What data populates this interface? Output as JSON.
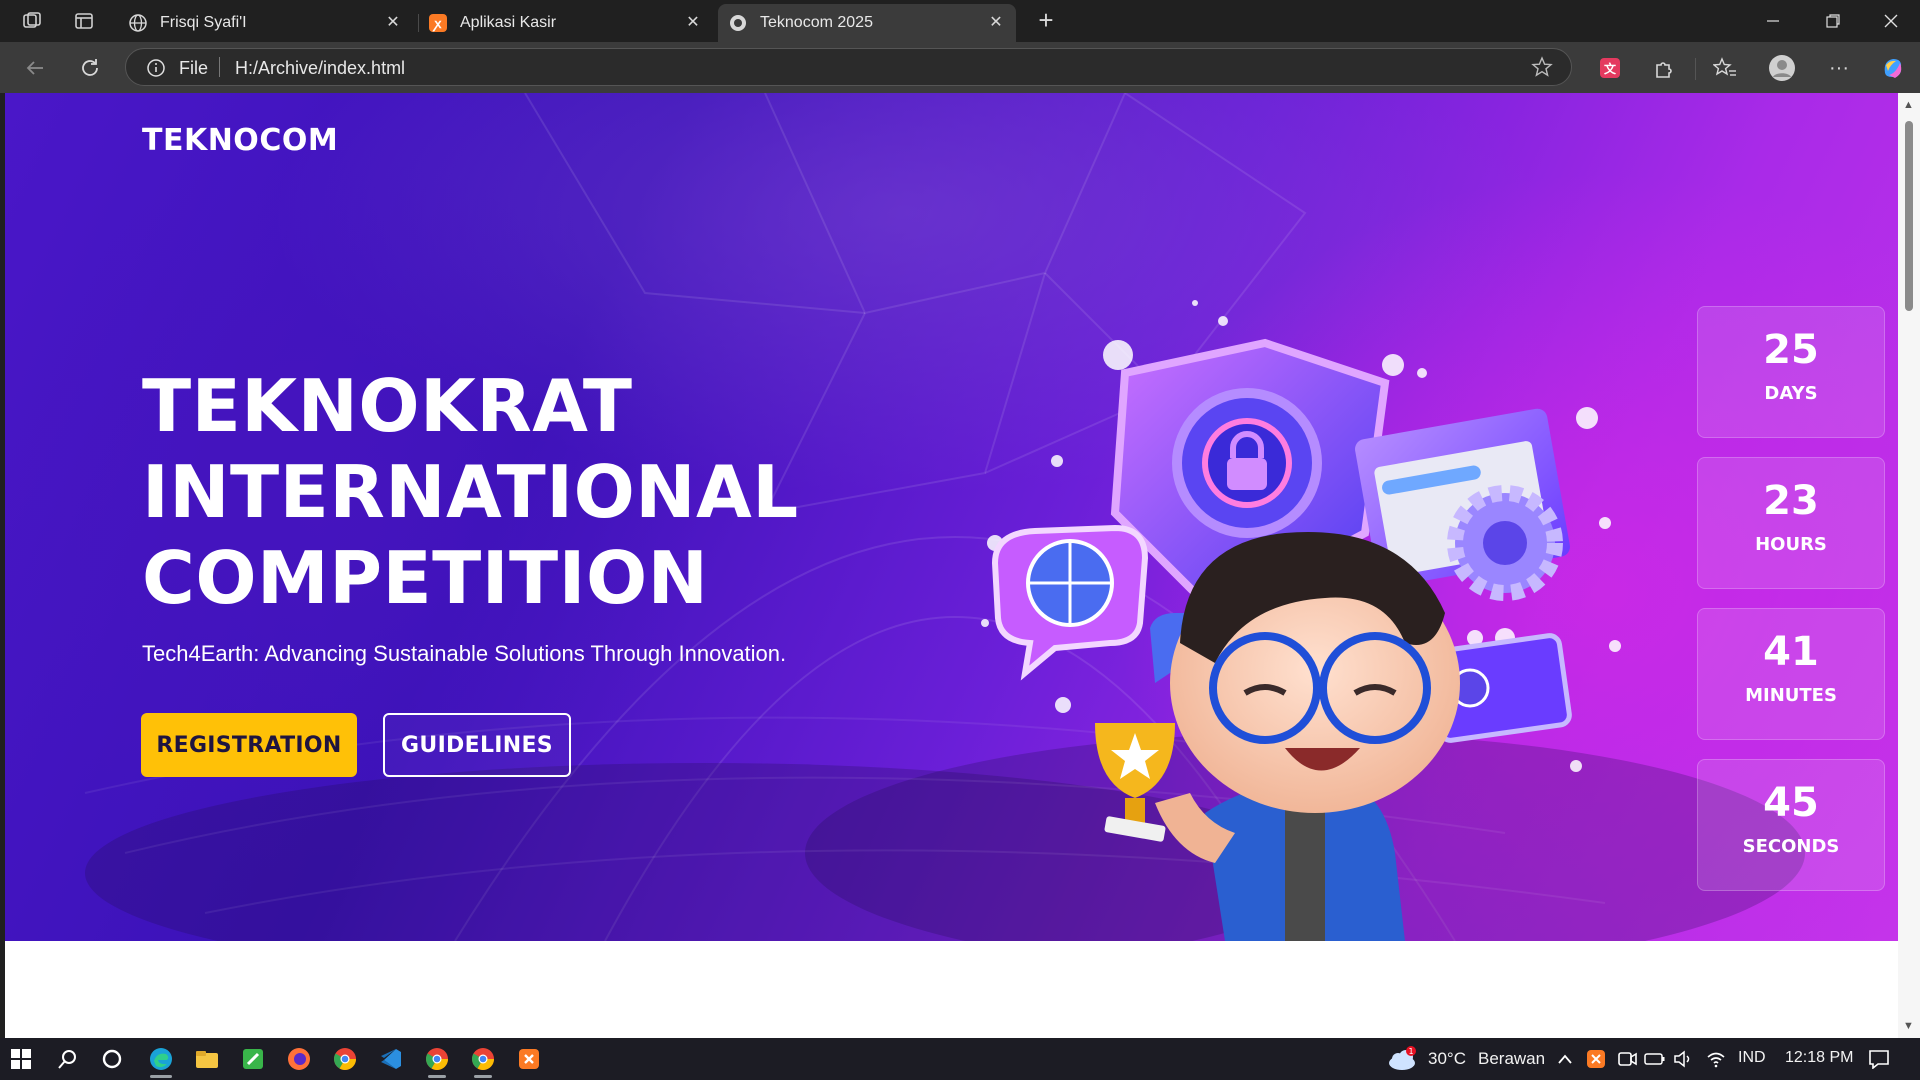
{
  "browser": {
    "tabs": [
      {
        "title": "Frisqi Syafi'I",
        "icon": "globe-icon",
        "active": false
      },
      {
        "title": "Aplikasi Kasir",
        "icon": "xampp-icon",
        "active": false
      },
      {
        "title": "Teknocom 2025",
        "icon": "teknocom-favicon",
        "active": true
      }
    ],
    "address": {
      "scheme_label": "File",
      "url": "H:/Archive/index.html"
    }
  },
  "page": {
    "brand": "TEKNOCOM",
    "headline": [
      "TEKNOKRAT",
      "INTERNATIONAL",
      "COMPETITION"
    ],
    "subtitle": "Tech4Earth: Advancing Sustainable Solutions Through Innovation.",
    "buttons": {
      "registration": "REGISTRATION",
      "guidelines": "GUIDELINES"
    },
    "countdown": [
      {
        "value": "25",
        "label": "DAYS"
      },
      {
        "value": "23",
        "label": "HOURS"
      },
      {
        "value": "41",
        "label": "MINUTES"
      },
      {
        "value": "45",
        "label": "SECONDS"
      }
    ],
    "colors": {
      "accent": "#ffc107",
      "hero_start": "#3b12b8",
      "hero_end": "#c534ea"
    }
  },
  "taskbar": {
    "weather": {
      "temp": "30°C",
      "condition": "Berawan",
      "badge": "1"
    },
    "language": "IND",
    "time": "12:18 PM"
  }
}
